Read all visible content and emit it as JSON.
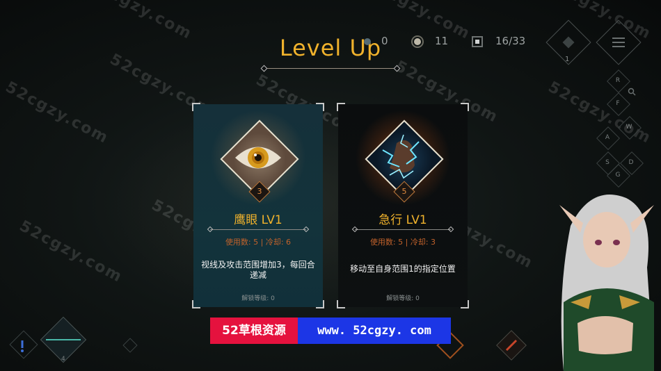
{
  "title": "Level Up",
  "hud": {
    "gems": "0",
    "coins": "11",
    "cards": "16/33",
    "corner_count": "1"
  },
  "keys": [
    "R",
    "F",
    "A",
    "W",
    "S",
    "D",
    "G"
  ],
  "cards": [
    {
      "name": "鹰眼 LV1",
      "level": "3",
      "stats": "使用数: 5 | 冷却: 6",
      "description": "视线及攻击范围增加3，每回合递减",
      "unlock": "解锁等级: 0"
    },
    {
      "name": "急行 LV1",
      "level": "5",
      "stats": "使用数: 5 | 冷却: 3",
      "description": "移动至自身范围1的指定位置",
      "unlock": "解锁等级: 0"
    }
  ],
  "banner": {
    "left": "52草根资源",
    "right": "www. 52cgzy. com"
  },
  "watermark": "52cgzy.com",
  "bottom_hint": "4"
}
